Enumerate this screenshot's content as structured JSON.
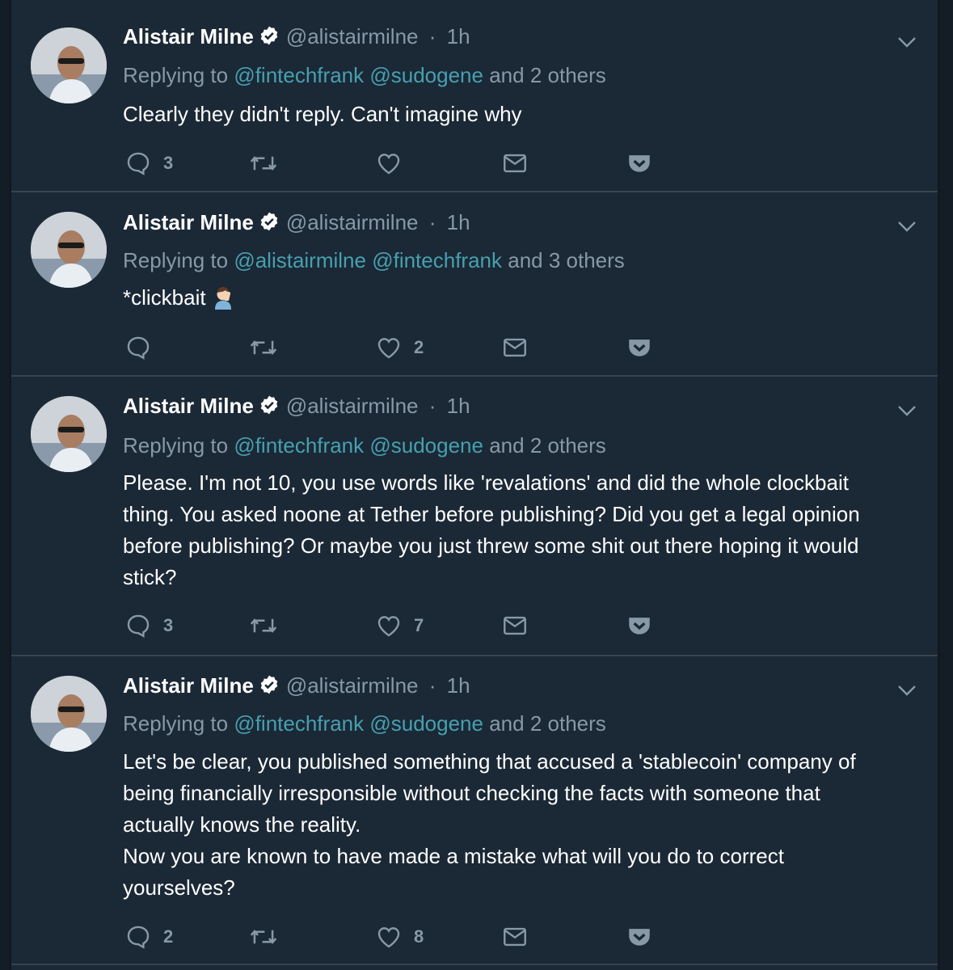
{
  "tweets": [
    {
      "name": "Alistair Milne",
      "handle": "@alistairmilne",
      "separator": "·",
      "time": "1h",
      "replying_prefix": "Replying to",
      "mentions": [
        "@fintechfrank",
        "@sudogene"
      ],
      "replying_suffix": "and 2 others",
      "text_lines": [
        "Clearly they didn't reply. Can't imagine why"
      ],
      "counts": {
        "replies": "3",
        "retweets": "",
        "likes": ""
      }
    },
    {
      "name": "Alistair Milne",
      "handle": "@alistairmilne",
      "separator": "·",
      "time": "1h",
      "replying_prefix": "Replying to",
      "mentions": [
        "@alistairmilne",
        "@fintechfrank"
      ],
      "replying_suffix": "and 3 others",
      "text_lines": [
        "*clickbait"
      ],
      "counts": {
        "replies": "",
        "retweets": "",
        "likes": "2"
      }
    },
    {
      "name": "Alistair Milne",
      "handle": "@alistairmilne",
      "separator": "·",
      "time": "1h",
      "replying_prefix": "Replying to",
      "mentions": [
        "@fintechfrank",
        "@sudogene"
      ],
      "replying_suffix": "and 2 others",
      "text_lines": [
        "Please. I'm not 10, you use words like 'revalations' and did the whole clockbait",
        "thing. You asked noone at Tether before publishing? Did you get a legal opinion",
        "before publishing? Or maybe you just threw some shit out there hoping it would",
        "stick?"
      ],
      "counts": {
        "replies": "3",
        "retweets": "",
        "likes": "7"
      }
    },
    {
      "name": "Alistair Milne",
      "handle": "@alistairmilne",
      "separator": "·",
      "time": "1h",
      "replying_prefix": "Replying to",
      "mentions": [
        "@fintechfrank",
        "@sudogene"
      ],
      "replying_suffix": "and 2 others",
      "text_lines": [
        "Let's be clear, you published something that accused a 'stablecoin' company of",
        "being financially irresponsible without checking the facts with someone that",
        "actually knows the reality.",
        "Now you are known to have made a mistake what will you do to correct",
        "yourselves?"
      ],
      "counts": {
        "replies": "2",
        "retweets": "",
        "likes": "8"
      }
    }
  ],
  "colors": {
    "background": "#1b2836",
    "divider": "#38444d",
    "muted": "#8899a6",
    "mention": "#47a0ae",
    "pocket": "#8899a6"
  },
  "icons": {
    "verified": "verified-badge-icon",
    "caret": "chevron-down-icon",
    "reply": "reply-icon",
    "retweet": "retweet-icon",
    "like": "heart-icon",
    "dm": "envelope-icon",
    "pocket": "pocket-icon",
    "emoji": "man-facepalming-emoji"
  }
}
